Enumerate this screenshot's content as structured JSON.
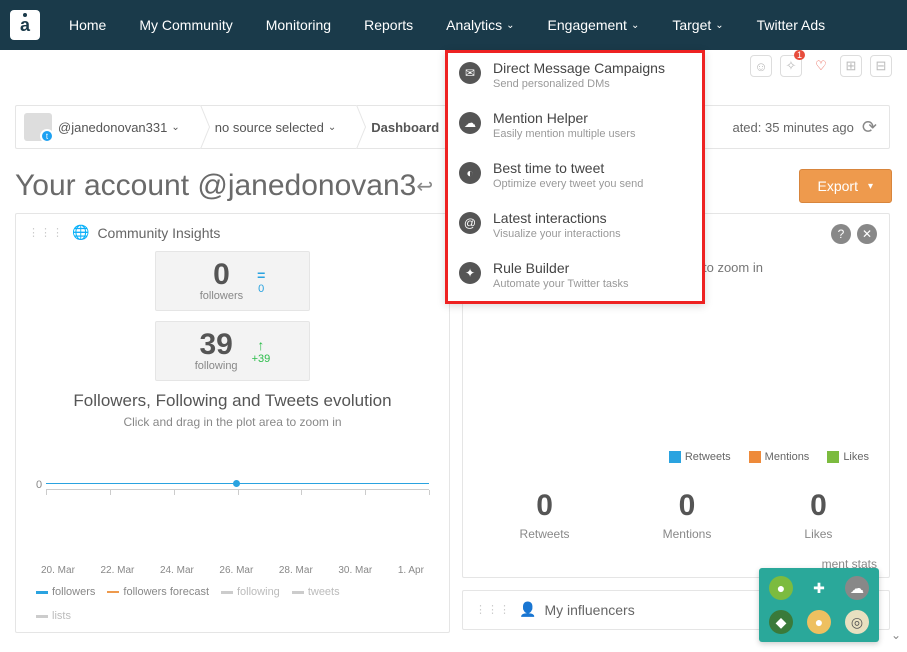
{
  "nav": {
    "items": [
      "Home",
      "My Community",
      "Monitoring",
      "Reports",
      "Analytics",
      "Engagement",
      "Target",
      "Twitter Ads"
    ],
    "dropdown_indices": [
      4,
      5,
      6
    ]
  },
  "iconbar": {
    "badge": "1"
  },
  "breadcrumb": {
    "account": "@janedonovan331",
    "source": "no source selected",
    "section": "Dashboard",
    "updated_prefix": "ated: ",
    "updated_value": "35 minutes ago"
  },
  "page_title": "Your account @janedonovan3",
  "export_label": "Export",
  "engagement_menu": [
    {
      "title": "Direct Message Campaigns",
      "sub": "Send personalized DMs",
      "icon": "envelope"
    },
    {
      "title": "Mention Helper",
      "sub": "Easily mention multiple users",
      "icon": "speech"
    },
    {
      "title": "Best time to tweet",
      "sub": "Optimize every tweet you send",
      "icon": "clock"
    },
    {
      "title": "Latest interactions",
      "sub": "Visualize your interactions",
      "icon": "at"
    },
    {
      "title": "Rule Builder",
      "sub": "Automate your Twitter tasks",
      "icon": "person-gear"
    }
  ],
  "community": {
    "heading": "Community Insights",
    "stats": {
      "followers": {
        "value": "0",
        "label": "followers",
        "delta": "0",
        "dir": "eq"
      },
      "following": {
        "value": "39",
        "label": "following",
        "delta": "+39",
        "dir": "up"
      }
    },
    "chart_title": "Followers, Following and Tweets evolution",
    "chart_sub": "Click and drag in the plot area to zoom in",
    "legend": [
      "followers",
      "followers forecast",
      "following",
      "tweets",
      "lists"
    ]
  },
  "chart_data": {
    "type": "line",
    "title": "Followers, Following and Tweets evolution",
    "xlabel": "",
    "ylabel": "",
    "x_ticks": [
      "20. Mar",
      "22. Mar",
      "24. Mar",
      "26. Mar",
      "28. Mar",
      "30. Mar",
      "1. Apr"
    ],
    "ylim": [
      0,
      0
    ],
    "series": [
      {
        "name": "followers",
        "color": "#2aa3e0",
        "values": [
          0,
          0,
          0,
          0,
          0,
          0,
          0
        ]
      },
      {
        "name": "followers forecast",
        "color": "#ee9a4d",
        "style": "dashed",
        "values": [
          null,
          null,
          null,
          null,
          null,
          null,
          null
        ]
      },
      {
        "name": "following",
        "color": "#bbbbbb",
        "values": [
          null,
          null,
          null,
          null,
          null,
          null,
          null
        ]
      },
      {
        "name": "tweets",
        "color": "#bbbbbb",
        "values": [
          null,
          null,
          null,
          null,
          null,
          null,
          null
        ]
      },
      {
        "name": "lists",
        "color": "#bbbbbb",
        "values": [
          null,
          null,
          null,
          null,
          null,
          null,
          null
        ]
      }
    ]
  },
  "right_hint": "to zoom in",
  "interactions": {
    "legend": [
      {
        "label": "Retweets",
        "color": "#2aa3e0"
      },
      {
        "label": "Mentions",
        "color": "#ee8a3a"
      },
      {
        "label": "Likes",
        "color": "#7cbb3f"
      }
    ],
    "stats": [
      {
        "value": "0",
        "label": "Retweets"
      },
      {
        "value": "0",
        "label": "Mentions"
      },
      {
        "value": "0",
        "label": "Likes"
      }
    ],
    "footer_text": "ment stats"
  },
  "influencers_heading": "My influencers",
  "y_tick": "0"
}
